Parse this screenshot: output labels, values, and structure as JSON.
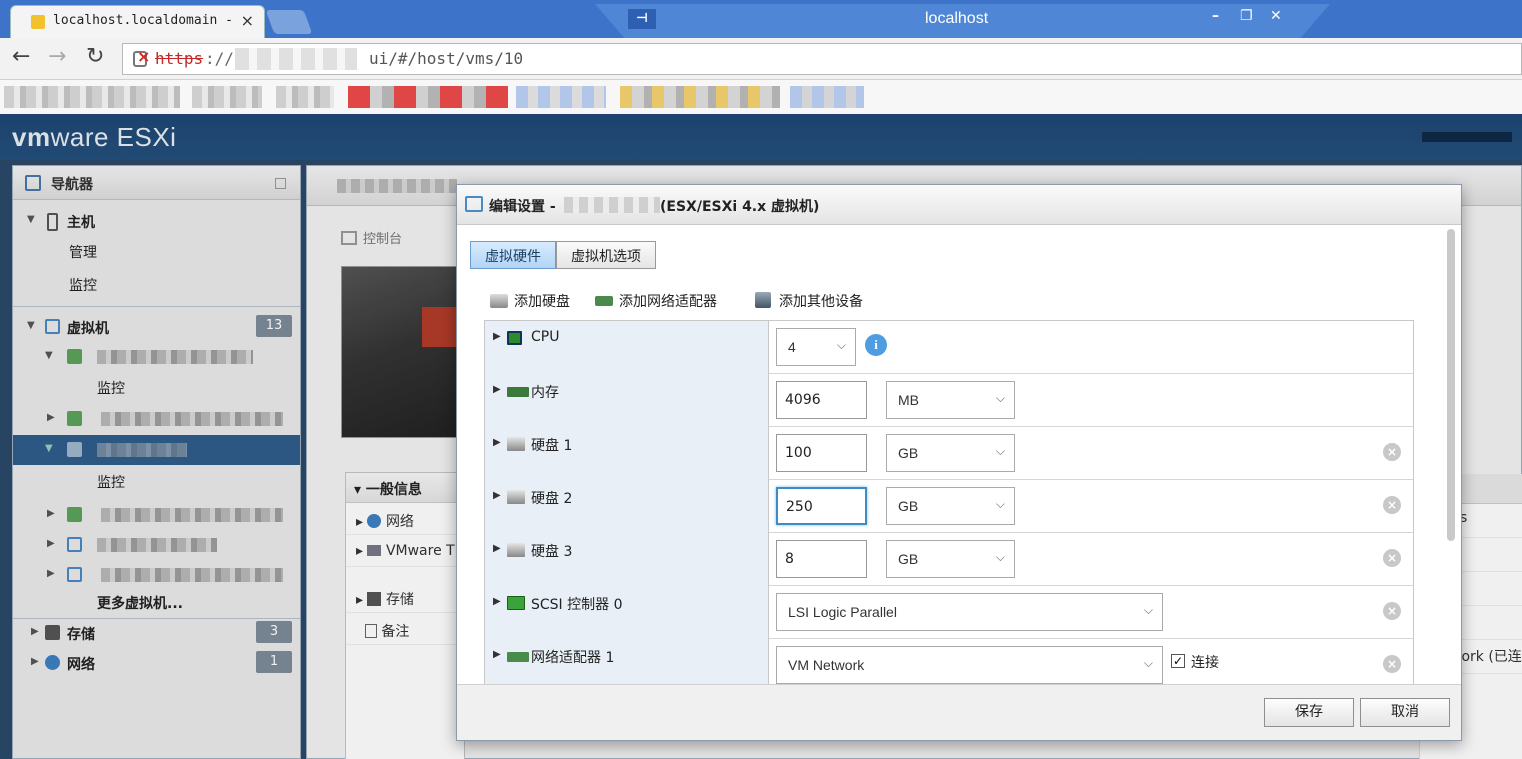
{
  "browser": {
    "tab_title": "localhost.localdomain -",
    "tab_close": "×",
    "remote_title": "localhost",
    "remote_pin": "⊣",
    "min": "–",
    "restore": "❐",
    "close": "✕",
    "back": "←",
    "forward": "→",
    "reload": "↻",
    "url_protocol": "https",
    "url_sep": "://",
    "url_path": "ui/#/host/vms/10"
  },
  "esxi": {
    "brand_vm": "vm",
    "brand_ware": "ware",
    "brand_product": " ESXi"
  },
  "navigator": {
    "title": "导航器",
    "host": "主机",
    "host_manage": "管理",
    "host_monitor": "监控",
    "vms": "虚拟机",
    "vms_count": "13",
    "vm1_monitor": "监控",
    "vm3_monitor": "监控",
    "more_vms": "更多虚拟机...",
    "storage": "存储",
    "storage_count": "3",
    "network": "网络",
    "network_count": "1"
  },
  "main": {
    "console": "控制台",
    "general_info": "一般信息",
    "network": "网络",
    "vmware_tools": "VMware T",
    "storage": "存储",
    "notes": "备注",
    "rp_s": "s",
    "rp_network": "work (已连"
  },
  "modal": {
    "title_prefix": "编辑设置 -",
    "title_suffix": "(ESX/ESXi 4.x 虚拟机)",
    "tab_hardware": "虚拟硬件",
    "tab_options": "虚拟机选项",
    "add_disk": "添加硬盘",
    "add_nic": "添加网络适配器",
    "add_other": "添加其他设备",
    "info": "i",
    "remove": "×",
    "check_mark": "✓",
    "save": "保存",
    "cancel": "取消",
    "chevron": "⌵",
    "hardware": [
      {
        "label": "CPU",
        "value": "4"
      },
      {
        "label": "内存",
        "value": "4096",
        "unit": "MB"
      },
      {
        "label": "硬盘 1",
        "value": "100",
        "unit": "GB"
      },
      {
        "label": "硬盘 2",
        "value": "250",
        "unit": "GB"
      },
      {
        "label": "硬盘 3",
        "value": "8",
        "unit": "GB"
      },
      {
        "label": "SCSI 控制器 0",
        "value": "LSI Logic Parallel"
      },
      {
        "label": "网络适配器 1",
        "value": "VM Network",
        "connect_label": "连接",
        "connected": true
      }
    ]
  }
}
